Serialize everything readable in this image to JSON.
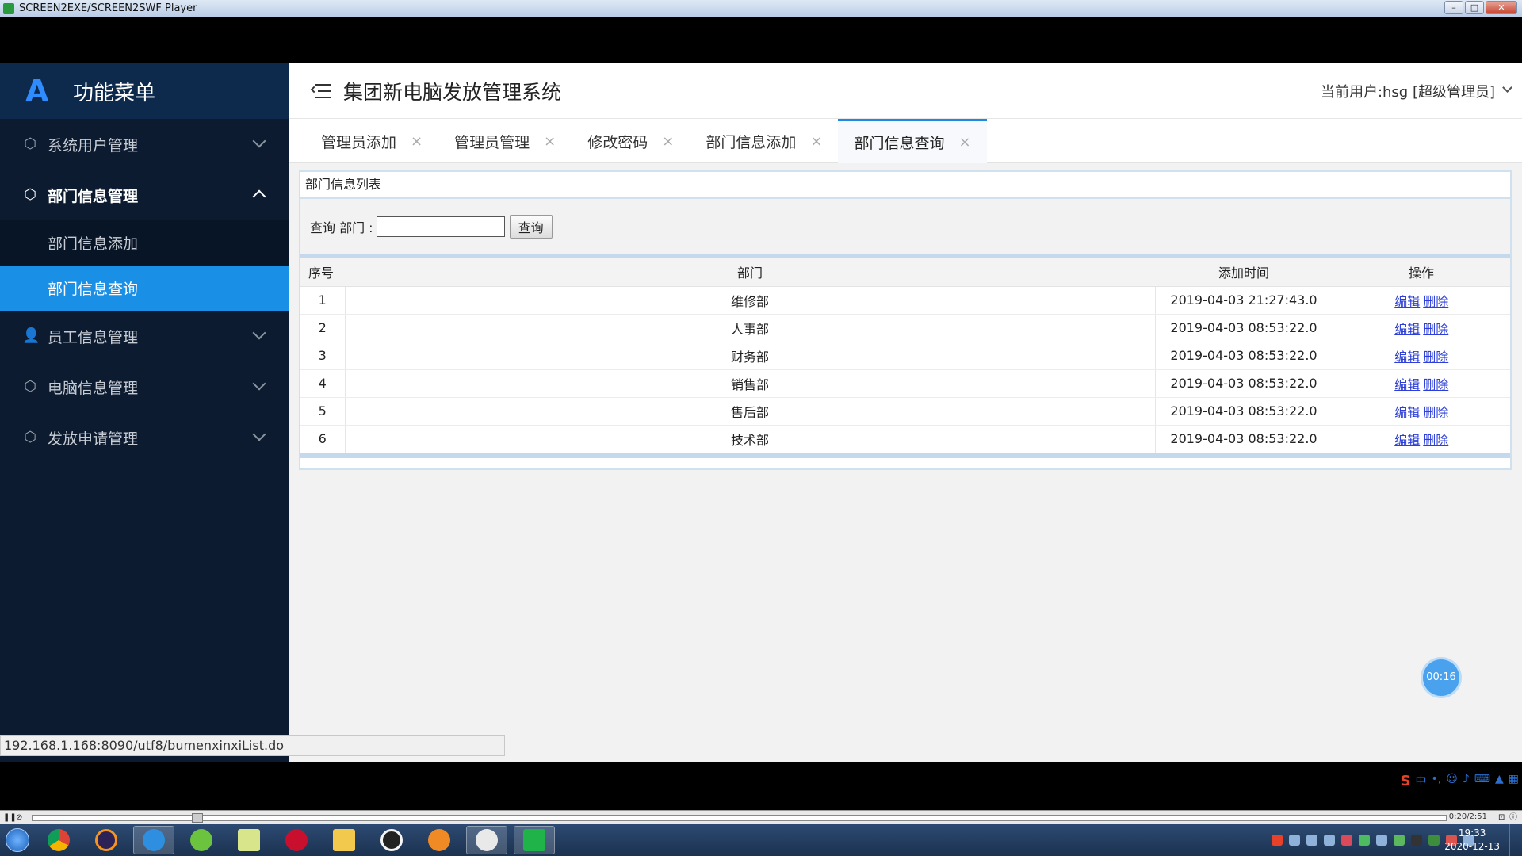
{
  "player": {
    "title": "SCREEN2EXE/SCREEN2SWF Player",
    "elapsed": "0:20/2:51",
    "progress": 0.117
  },
  "sidebar": {
    "brand": "功能菜单",
    "groups": [
      {
        "label": "系统用户管理",
        "icon": "cube-icon",
        "open": false
      },
      {
        "label": "部门信息管理",
        "icon": "cube-icon",
        "open": true,
        "items": [
          {
            "label": "部门信息添加",
            "active": false
          },
          {
            "label": "部门信息查询",
            "active": true
          }
        ]
      },
      {
        "label": "员工信息管理",
        "icon": "user-icon",
        "open": false
      },
      {
        "label": "电脑信息管理",
        "icon": "cube-icon",
        "open": false
      },
      {
        "label": "发放申请管理",
        "icon": "cube-icon",
        "open": false
      }
    ]
  },
  "header": {
    "title": "集团新电脑发放管理系统",
    "user": "当前用户:hsg [超级管理员]"
  },
  "tabs": [
    {
      "label": "管理员添加",
      "close": "×",
      "active": false
    },
    {
      "label": "管理员管理",
      "close": "×",
      "active": false
    },
    {
      "label": "修改密码",
      "close": "×",
      "active": false
    },
    {
      "label": "部门信息添加",
      "close": "×",
      "active": false
    },
    {
      "label": "部门信息查询",
      "close": "×",
      "active": true
    }
  ],
  "panel": {
    "title": "部门信息列表",
    "search_label": "查询 部门 :",
    "search_value": "",
    "search_button": "查询"
  },
  "table": {
    "headers": [
      "序号",
      "部门",
      "添加时间",
      "操作"
    ],
    "edit_label": "编辑",
    "delete_label": "删除",
    "rows": [
      {
        "seq": "1",
        "dept": "维修部",
        "time": "2019-04-03 21:27:43.0"
      },
      {
        "seq": "2",
        "dept": "人事部",
        "time": "2019-04-03 08:53:22.0"
      },
      {
        "seq": "3",
        "dept": "财务部",
        "time": "2019-04-03 08:53:22.0"
      },
      {
        "seq": "4",
        "dept": "销售部",
        "time": "2019-04-03 08:53:22.0"
      },
      {
        "seq": "5",
        "dept": "售后部",
        "time": "2019-04-03 08:53:22.0"
      },
      {
        "seq": "6",
        "dept": "技术部",
        "time": "2019-04-03 08:53:22.0"
      }
    ]
  },
  "timer": "00:16",
  "status_url": "192.168.1.168:8090/utf8/bumenxinxiList.do",
  "ime": {
    "logo": "S",
    "mode": "中"
  },
  "clock": {
    "time": "19:33",
    "date": "2020-12-13"
  },
  "colors": {
    "sidebar_bg": "#0c1b30",
    "active_item": "#1a8fe6",
    "tab_accent": "#1e88e5",
    "link": "#2d3fd8"
  }
}
